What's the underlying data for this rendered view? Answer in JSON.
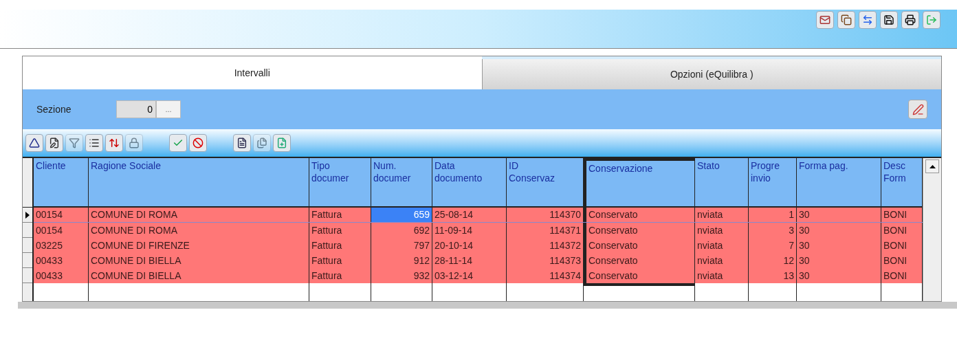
{
  "top_toolbar": [
    {
      "kind": "mail",
      "disabled": false
    },
    {
      "kind": "copy",
      "disabled": false
    },
    {
      "kind": "sync",
      "disabled": false
    },
    {
      "kind": "save",
      "disabled": false
    },
    {
      "kind": "print",
      "disabled": false
    },
    {
      "kind": "exit",
      "disabled": false
    }
  ],
  "tabs": [
    {
      "label": "Intervalli",
      "selected": true
    },
    {
      "label": "Opzioni (eQuilibra )",
      "selected": false
    }
  ],
  "sezione": {
    "label": "Sezione",
    "value": "0",
    "browse": "..."
  },
  "grid_toolbar": [
    {
      "kind": "up",
      "disabled": false
    },
    {
      "kind": "edit",
      "disabled": false
    },
    {
      "kind": "filter",
      "disabled": true
    },
    {
      "kind": "list",
      "disabled": false
    },
    {
      "kind": "export",
      "disabled": false
    },
    {
      "kind": "lock",
      "disabled": true
    },
    {
      "kind": "gap"
    },
    {
      "kind": "ok",
      "disabled": false
    },
    {
      "kind": "cancel",
      "disabled": false
    },
    {
      "kind": "gap"
    },
    {
      "kind": "doc",
      "disabled": false
    },
    {
      "kind": "docs",
      "disabled": true
    },
    {
      "kind": "add",
      "disabled": false
    }
  ],
  "table": {
    "columns": [
      {
        "lines": [
          "Cliente"
        ],
        "kind": "text",
        "highlighted": false
      },
      {
        "lines": [
          "Ragione Sociale"
        ],
        "kind": "text",
        "highlighted": false
      },
      {
        "lines": [
          "Tipo",
          "documer"
        ],
        "kind": "text",
        "highlighted": false
      },
      {
        "lines": [
          "Num.",
          "documer"
        ],
        "kind": "number",
        "highlighted": false
      },
      {
        "lines": [
          "Data",
          "documento"
        ],
        "kind": "text",
        "highlighted": false
      },
      {
        "lines": [
          "ID",
          "Conservaz"
        ],
        "kind": "number",
        "highlighted": false
      },
      {
        "lines": [
          "Conservazione"
        ],
        "kind": "text",
        "highlighted": true
      },
      {
        "lines": [
          "Stato"
        ],
        "kind": "text",
        "highlighted": false
      },
      {
        "lines": [
          "Progre",
          "invio"
        ],
        "kind": "number",
        "highlighted": false
      },
      {
        "lines": [
          "Forma pag."
        ],
        "kind": "text",
        "highlighted": false
      },
      {
        "lines": [
          "Desc",
          "Form"
        ],
        "kind": "text",
        "highlighted": false
      }
    ],
    "rows": [
      {
        "current": true,
        "cells": [
          {
            "text": "00154",
            "selected": false
          },
          {
            "text": "COMUNE DI ROMA",
            "selected": false
          },
          {
            "text": "Fattura",
            "selected": false
          },
          {
            "text": "659",
            "selected": true
          },
          {
            "text": "25-08-14",
            "selected": false
          },
          {
            "text": "114370",
            "selected": false
          },
          {
            "text": "Conservato",
            "selected": false
          },
          {
            "text": "nviata",
            "selected": false
          },
          {
            "text": "1",
            "selected": false
          },
          {
            "text": "30",
            "selected": false
          },
          {
            "text": "BONI",
            "selected": false
          }
        ]
      },
      {
        "current": false,
        "cells": [
          {
            "text": "00154",
            "selected": false
          },
          {
            "text": "COMUNE DI ROMA",
            "selected": false
          },
          {
            "text": "Fattura",
            "selected": false
          },
          {
            "text": "692",
            "selected": false
          },
          {
            "text": "11-09-14",
            "selected": false
          },
          {
            "text": "114371",
            "selected": false
          },
          {
            "text": "Conservato",
            "selected": false
          },
          {
            "text": "nviata",
            "selected": false
          },
          {
            "text": "3",
            "selected": false
          },
          {
            "text": "30",
            "selected": false
          },
          {
            "text": "BONI",
            "selected": false
          }
        ]
      },
      {
        "current": false,
        "cells": [
          {
            "text": "03225",
            "selected": false
          },
          {
            "text": "COMUNE DI FIRENZE",
            "selected": false
          },
          {
            "text": "Fattura",
            "selected": false
          },
          {
            "text": "797",
            "selected": false
          },
          {
            "text": "20-10-14",
            "selected": false
          },
          {
            "text": "114372",
            "selected": false
          },
          {
            "text": "Conservato",
            "selected": false
          },
          {
            "text": "nviata",
            "selected": false
          },
          {
            "text": "7",
            "selected": false
          },
          {
            "text": "30",
            "selected": false
          },
          {
            "text": "BONI",
            "selected": false
          }
        ]
      },
      {
        "current": false,
        "cells": [
          {
            "text": "00433",
            "selected": false
          },
          {
            "text": "COMUNE DI BIELLA",
            "selected": false
          },
          {
            "text": "Fattura",
            "selected": false
          },
          {
            "text": "912",
            "selected": false
          },
          {
            "text": "28-11-14",
            "selected": false
          },
          {
            "text": "114373",
            "selected": false
          },
          {
            "text": "Conservato",
            "selected": false
          },
          {
            "text": "nviata",
            "selected": false
          },
          {
            "text": "12",
            "selected": false
          },
          {
            "text": "30",
            "selected": false
          },
          {
            "text": "BONI",
            "selected": false
          }
        ]
      },
      {
        "current": false,
        "cells": [
          {
            "text": "00433",
            "selected": false
          },
          {
            "text": "COMUNE DI BIELLA",
            "selected": false
          },
          {
            "text": "Fattura",
            "selected": false
          },
          {
            "text": "932",
            "selected": false
          },
          {
            "text": "03-12-14",
            "selected": false
          },
          {
            "text": "114374",
            "selected": false
          },
          {
            "text": "Conservato",
            "selected": false
          },
          {
            "text": "nviata",
            "selected": false
          },
          {
            "text": "13",
            "selected": false
          },
          {
            "text": "30",
            "selected": false
          },
          {
            "text": "BONI",
            "selected": false
          }
        ]
      }
    ]
  }
}
